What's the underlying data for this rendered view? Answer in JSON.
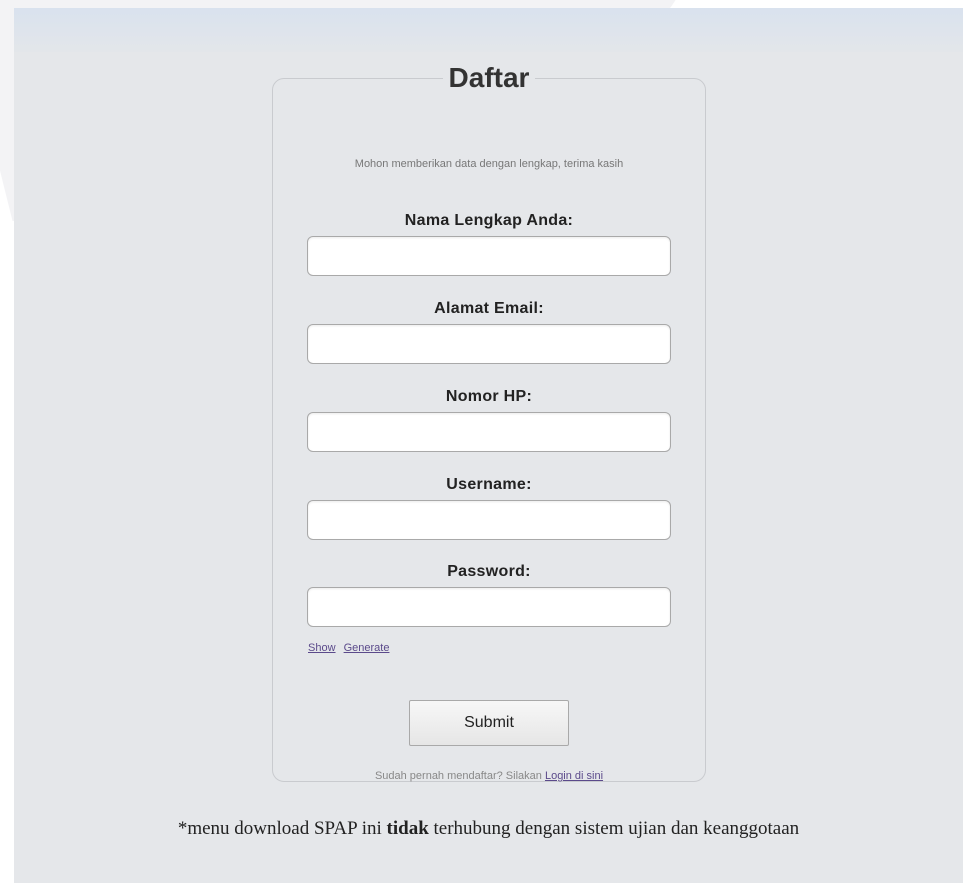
{
  "form": {
    "title": "Daftar",
    "intro": "Mohon memberikan data dengan lengkap, terima kasih",
    "fields": {
      "nama_label": "Nama Lengkap Anda:",
      "nama_value": "",
      "email_label": "Alamat Email:",
      "email_value": "",
      "hp_label": "Nomor HP:",
      "hp_value": "",
      "username_label": "Username:",
      "username_value": "",
      "password_label": "Password:",
      "password_value": ""
    },
    "show_link": "Show",
    "generate_link": "Generate",
    "submit_label": "Submit",
    "login_prefix": "Sudah pernah mendaftar? Silakan",
    "login_link": "Login di sini"
  },
  "footnote": {
    "prefix": "*menu download SPAP ini",
    "bold": "tidak",
    "suffix": "terhubung dengan sistem ujian dan keanggotaan"
  }
}
